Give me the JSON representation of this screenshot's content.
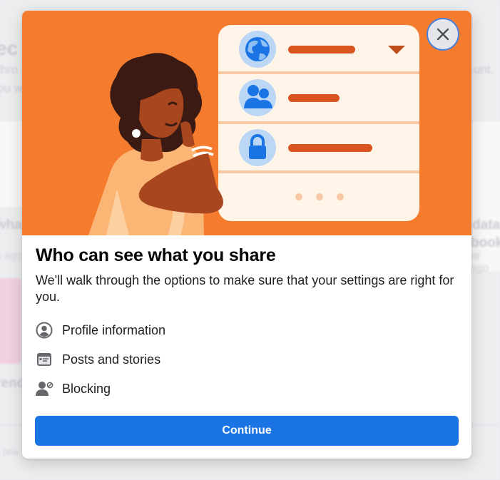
{
  "modal": {
    "title": "Who can see what you share",
    "description": "We'll walk through the options to make sure that your settings are right for you.",
    "options": [
      {
        "label": "Profile information",
        "icon": "profile-circle-icon"
      },
      {
        "label": "Posts and stories",
        "icon": "posts-card-icon"
      },
      {
        "label": "Blocking",
        "icon": "blocking-user-icon"
      }
    ],
    "continue_label": "Continue",
    "close_icon": "close-icon"
  },
  "background": {
    "heading_fragment": "ec",
    "text_fragments": [
      "thro",
      "ou w",
      "unt."
    ],
    "card_titles": [
      "wha",
      "data",
      "book",
      "rend"
    ],
    "card_subs": [
      "s ago",
      "ar ago"
    ],
    "footer_fragment": "priv"
  },
  "colors": {
    "hero_orange": "#f57c2f",
    "primary_blue": "#1b74e4",
    "accent_dark_orange": "#d9541e",
    "panel_cream": "#fff4e8"
  }
}
